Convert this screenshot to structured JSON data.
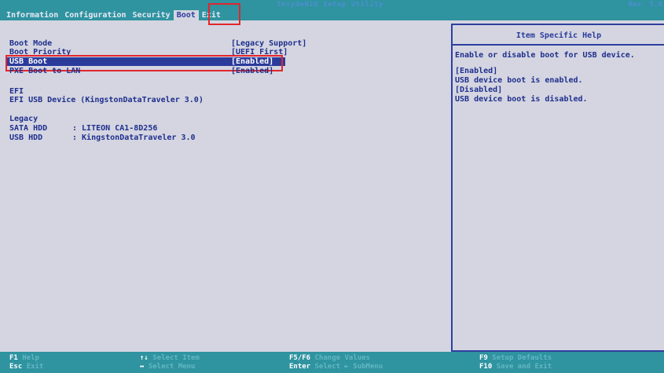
{
  "header": {
    "title": "InsydeH2O Setup Utility",
    "rev": "Rev. 5.0",
    "menu": [
      "Information",
      "Configuration",
      "Security",
      "Boot",
      "Exit"
    ]
  },
  "boot": {
    "boot_mode_label": "Boot Mode",
    "boot_mode_value": "[Legacy Support]",
    "boot_priority_label": "Boot Priority",
    "boot_priority_value": "[UEFI First]",
    "usb_boot_label": "USB Boot",
    "usb_boot_value": "[Enabled]",
    "pxe_label": "PXE Boot to LAN",
    "pxe_value": "[Enabled]",
    "efi_header": "EFI",
    "efi_device": "EFI USB Device (KingstonDataTraveler 3.0)",
    "legacy_header": "Legacy",
    "legacy_devices": [
      {
        "type": "SATA HDD",
        "name": ": LITEON CA1-8D256"
      },
      {
        "type": "USB HDD",
        "name": ": KingstonDataTraveler 3.0"
      }
    ]
  },
  "help": {
    "title": "Item Specific Help",
    "lines": [
      "Enable or disable boot for USB device.",
      "",
      "[Enabled]",
      "USB device boot is enabled.",
      "[Disabled]",
      "USB device boot is disabled."
    ]
  },
  "footer": {
    "keys": [
      {
        "key": "F1",
        "desc": "Help"
      },
      {
        "key": "Esc",
        "desc": "Exit"
      },
      {
        "key": "↑↓",
        "desc": "Select Item"
      },
      {
        "key": "↔",
        "desc": "Select Menu"
      },
      {
        "key": "F5/F6",
        "desc": "Change Values"
      },
      {
        "key": "Enter",
        "desc": "Select ► SubMenu"
      },
      {
        "key": "F9",
        "desc": "Setup Defaults"
      },
      {
        "key": "F10",
        "desc": "Save and Exit"
      }
    ]
  },
  "colors": {
    "bar": "#2f93a0",
    "background": "#d4d5e1",
    "text": "#1f2f8c",
    "selection": "#2b3b9c",
    "annotation": "#e1262c"
  }
}
